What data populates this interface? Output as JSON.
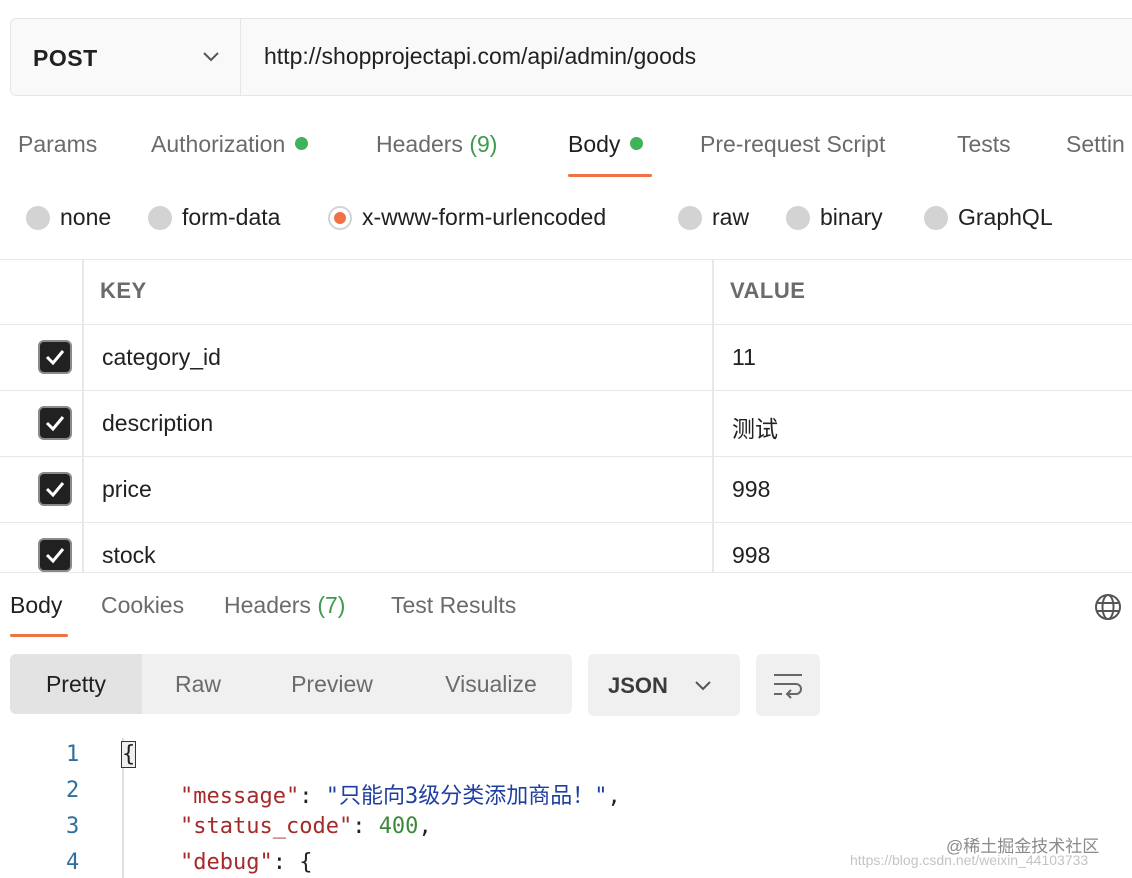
{
  "request": {
    "method": "POST",
    "url": "http://shopprojectapi.com/api/admin/goods"
  },
  "request_tabs": {
    "params": "Params",
    "authorization": "Authorization",
    "headers": "Headers",
    "headers_count": "(9)",
    "body": "Body",
    "prerequest": "Pre-request Script",
    "tests": "Tests",
    "settings": "Settin"
  },
  "body_types": {
    "none": "none",
    "form_data": "form-data",
    "urlencoded": "x-www-form-urlencoded",
    "raw": "raw",
    "binary": "binary",
    "graphql": "GraphQL",
    "selected": "x-www-form-urlencoded"
  },
  "params_table": {
    "headers": {
      "key": "KEY",
      "value": "VALUE"
    },
    "rows": [
      {
        "key": "category_id",
        "value": "11",
        "checked": true
      },
      {
        "key": "description",
        "value": "测试",
        "checked": true
      },
      {
        "key": "price",
        "value": "998",
        "checked": true
      },
      {
        "key": "stock",
        "value": "998",
        "checked": true
      }
    ]
  },
  "response_tabs": {
    "body": "Body",
    "cookies": "Cookies",
    "headers": "Headers",
    "headers_count": "(7)",
    "test_results": "Test Results"
  },
  "view_modes": {
    "pretty": "Pretty",
    "raw": "Raw",
    "preview": "Preview",
    "visualize": "Visualize"
  },
  "format": {
    "selected": "JSON"
  },
  "code": {
    "lines": [
      {
        "no": "1",
        "open": "{"
      },
      {
        "no": "2",
        "key": "\"message\"",
        "colon": ": ",
        "value": "\"只能向3级分类添加商品！\"",
        "tail": ","
      },
      {
        "no": "3",
        "key": "\"status_code\"",
        "colon": ": ",
        "value": "400",
        "tail": ","
      },
      {
        "no": "4",
        "key": "\"debug\"",
        "colon": ": ",
        "value": "{"
      }
    ]
  },
  "watermark": {
    "site": "@稀土掘金技术社区",
    "url": "https://blog.csdn.net/weixin_44103733"
  },
  "colors": {
    "accent": "#ef7144",
    "green_dot": "#3fb35a"
  },
  "icons": {
    "method_dropdown": "chevron-down-icon",
    "format_dropdown": "chevron-down-icon",
    "wrap": "wrap-lines-icon",
    "globe": "globe-icon",
    "checkbox": "checkmark-icon"
  }
}
